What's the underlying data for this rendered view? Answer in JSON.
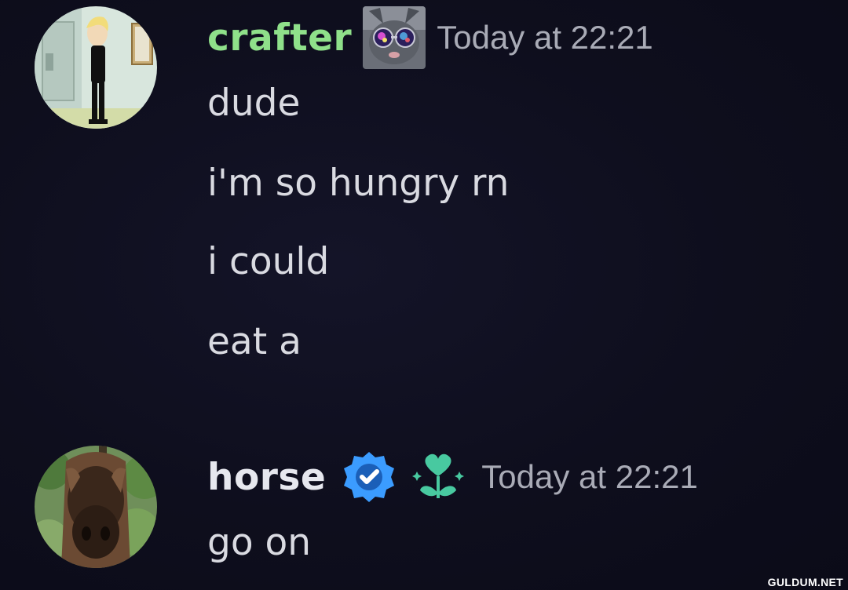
{
  "messages": [
    {
      "username": "crafter",
      "username_color": "#8fe08a",
      "role_icon": "cat-sunglasses-icon",
      "timestamp": "Today at 22:21",
      "lines": [
        "dude",
        "i'm so hungry rn",
        "i could",
        "eat a"
      ]
    },
    {
      "username": "horse",
      "username_color": "#e6e7ee",
      "badges": [
        "verified-check-icon",
        "heart-flower-icon"
      ],
      "badge_colors": {
        "verified": "#3b9cff",
        "flower": "#48c9a0"
      },
      "timestamp": "Today at 22:21",
      "lines": [
        "go on"
      ]
    }
  ],
  "watermark": "GULDUM.NET"
}
